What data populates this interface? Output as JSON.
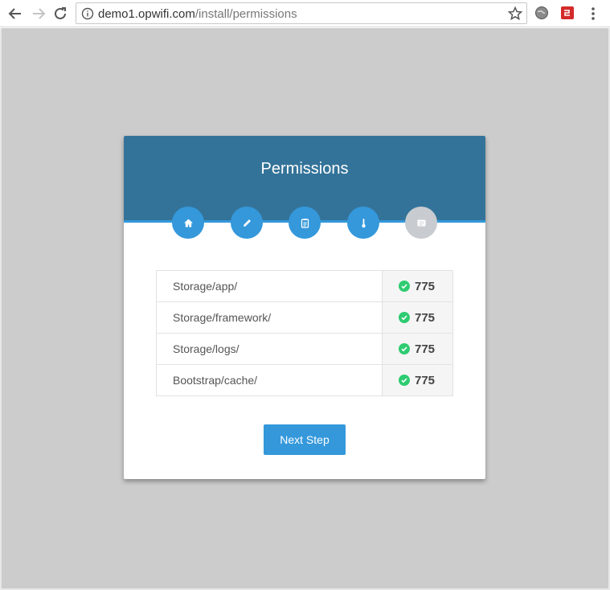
{
  "browser": {
    "url_host": "demo1.opwifi.com",
    "url_path": "/install/permissions"
  },
  "card": {
    "title": "Permissions",
    "steps": [
      {
        "icon": "home-icon",
        "state": "done"
      },
      {
        "icon": "pencil-icon",
        "state": "done"
      },
      {
        "icon": "clipboard-icon",
        "state": "done"
      },
      {
        "icon": "thermometer-icon",
        "state": "done"
      },
      {
        "icon": "list-icon",
        "state": "pending"
      }
    ],
    "permissions": [
      {
        "path": "Storage/app/",
        "value": "775"
      },
      {
        "path": "Storage/framework/",
        "value": "775"
      },
      {
        "path": "Storage/logs/",
        "value": "775"
      },
      {
        "path": "Bootstrap/cache/",
        "value": "775"
      }
    ],
    "next_label": "Next Step"
  },
  "colors": {
    "header": "#347399",
    "accent": "#3498db",
    "pending": "#c8ccd0",
    "ok": "#2ecc71",
    "background": "#cccccc"
  }
}
